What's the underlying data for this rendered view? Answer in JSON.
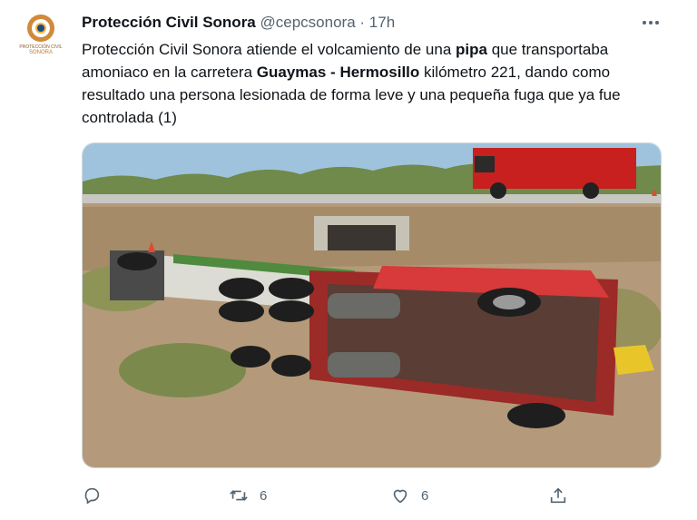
{
  "author": {
    "name": "Protección Civil Sonora",
    "handle": "@cepcsonora",
    "separator": "·",
    "time": "17h",
    "logo_text_line1": "PROTECCIÓN CIVIL",
    "logo_text_line2": "SONORA"
  },
  "tweet": {
    "text_parts": [
      "Protección Civil Sonora atiende el volcamiento de una ",
      "pipa",
      " que transportaba amoniaco en la carretera ",
      "Guaymas",
      " - ",
      "Hermosillo",
      " kilómetro 221, dando como resultado una persona lesionada de forma leve y una pequeña fuga que ya fue controlada (1)"
    ]
  },
  "media": {
    "description_icon": "photo-overturned-tanker-truck"
  },
  "actions": {
    "reply_count": "",
    "retweet_count": "6",
    "like_count": "6"
  },
  "colors": {
    "text": "#0f1419",
    "secondary": "#536471",
    "border": "#cfd9de"
  }
}
